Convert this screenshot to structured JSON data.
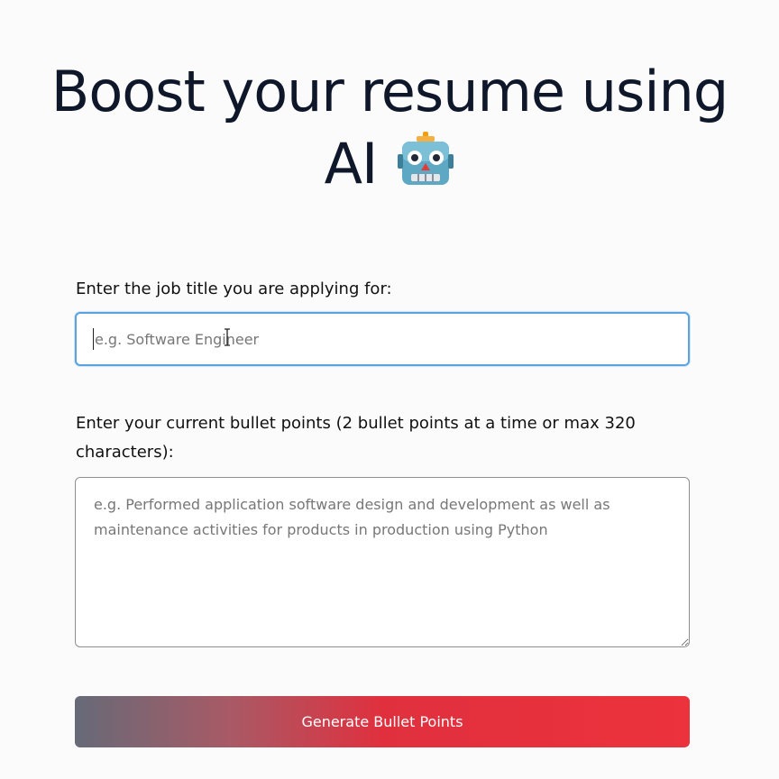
{
  "hero": {
    "title_line1": "Boost your resume using",
    "title_line2": "AI"
  },
  "form": {
    "job_title": {
      "label": "Enter the job title you are applying for:",
      "placeholder": "e.g. Software Engineer",
      "value": ""
    },
    "bullets": {
      "label": "Enter your current bullet points (2 bullet points at a time or max 320 characters):",
      "placeholder": "e.g. Performed application software design and development as well as maintenance activities for products in production using Python",
      "value": ""
    },
    "generate_label": "Generate Bullet Points"
  },
  "icons": {
    "robot": "robot-face-emoji",
    "cursor": "text-ibeam-cursor"
  },
  "colors": {
    "focus_border": "#5aa2e0",
    "button_gradient_start": "#666a78",
    "button_gradient_end": "#ec323c",
    "button_text": "#ffffff"
  }
}
